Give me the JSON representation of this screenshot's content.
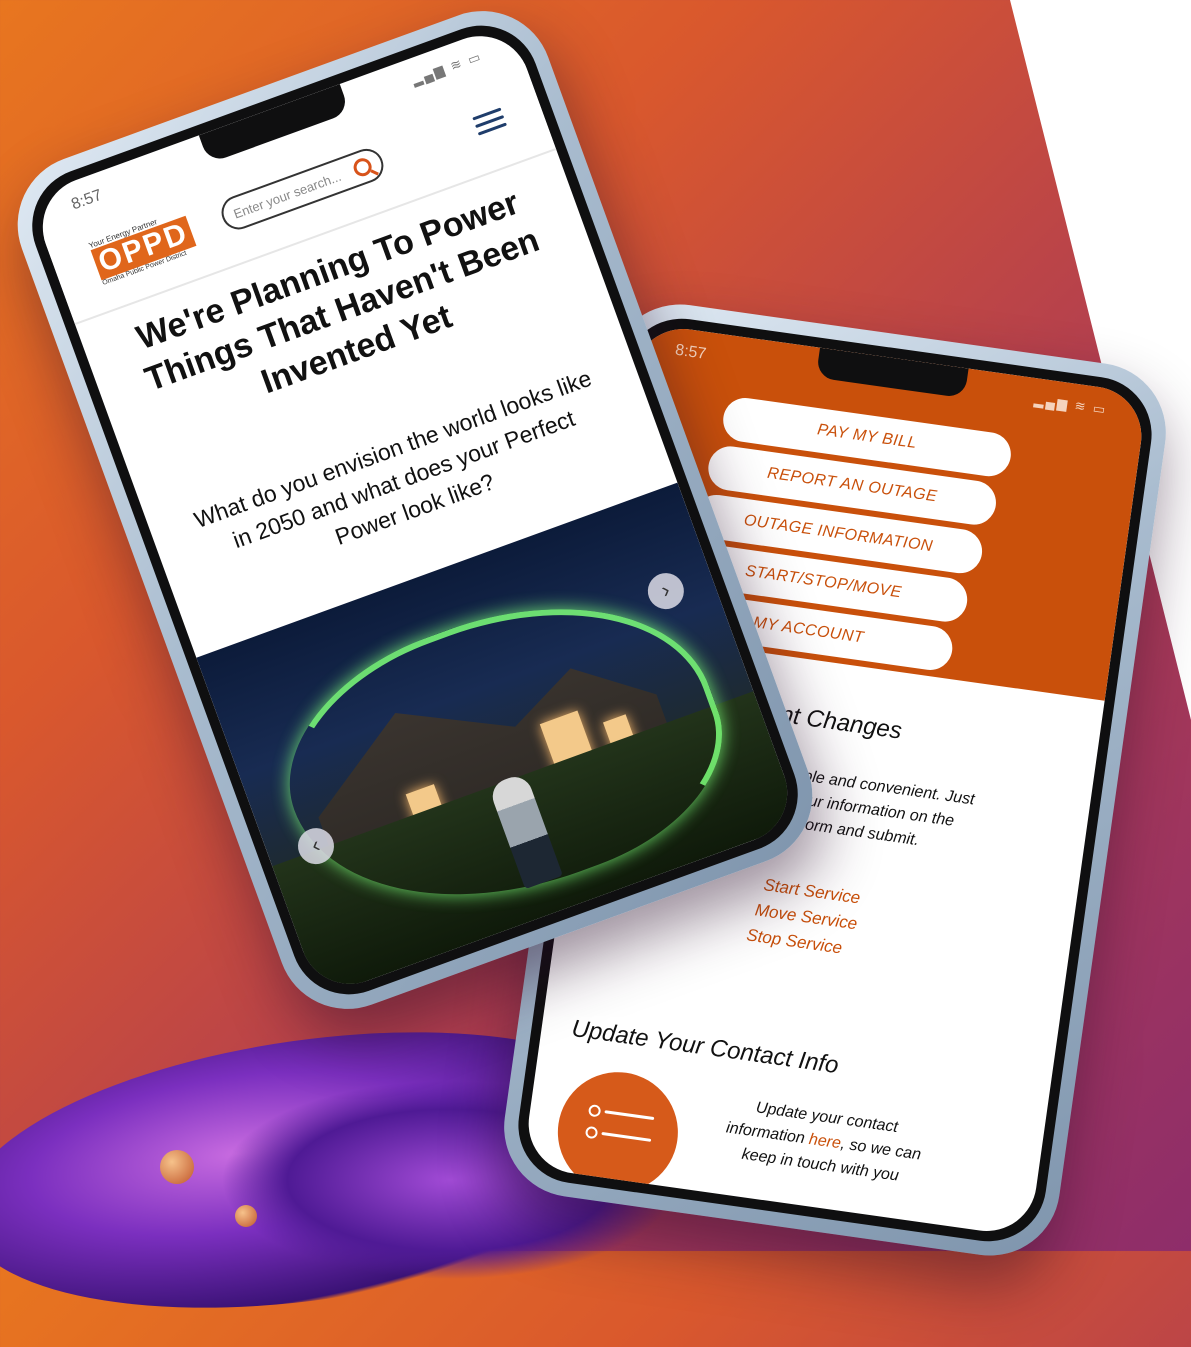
{
  "colors": {
    "accent": "#c9500b",
    "logo_orange": "#e0661b",
    "menu_blue": "#1f3d6b"
  },
  "phone1": {
    "status_time": "8:57",
    "logo": {
      "tagline": "Your Energy Partner",
      "name": "OPPD",
      "subtitle": "Omaha Public Power District"
    },
    "search_placeholder": "Enter your search...",
    "headline": "We're Planning To Power Things That Haven't Been Invented Yet",
    "subhead": "What do you envision the world looks like in 2050 and what does your Perfect Power look like?",
    "carousel": {
      "prev": "‹",
      "next": "›"
    }
  },
  "phone2": {
    "status_time": "8:57",
    "buttons": [
      "PAY MY BILL",
      "REPORT AN OUTAGE",
      "OUTAGE INFORMATION",
      "START/STOP/MOVE",
      "MY ACCOUNT"
    ],
    "section1": {
      "title": "Service Account Changes",
      "body": "It's simple and convenient. Just enter your information on the correct form and submit.",
      "links": [
        "Start Service",
        "Move Service",
        "Stop Service"
      ]
    },
    "section2": {
      "title": "Update Your Contact Info",
      "body_pre": "Update your contact information ",
      "link": "here",
      "body_post": ", so we can keep in touch with you"
    }
  }
}
